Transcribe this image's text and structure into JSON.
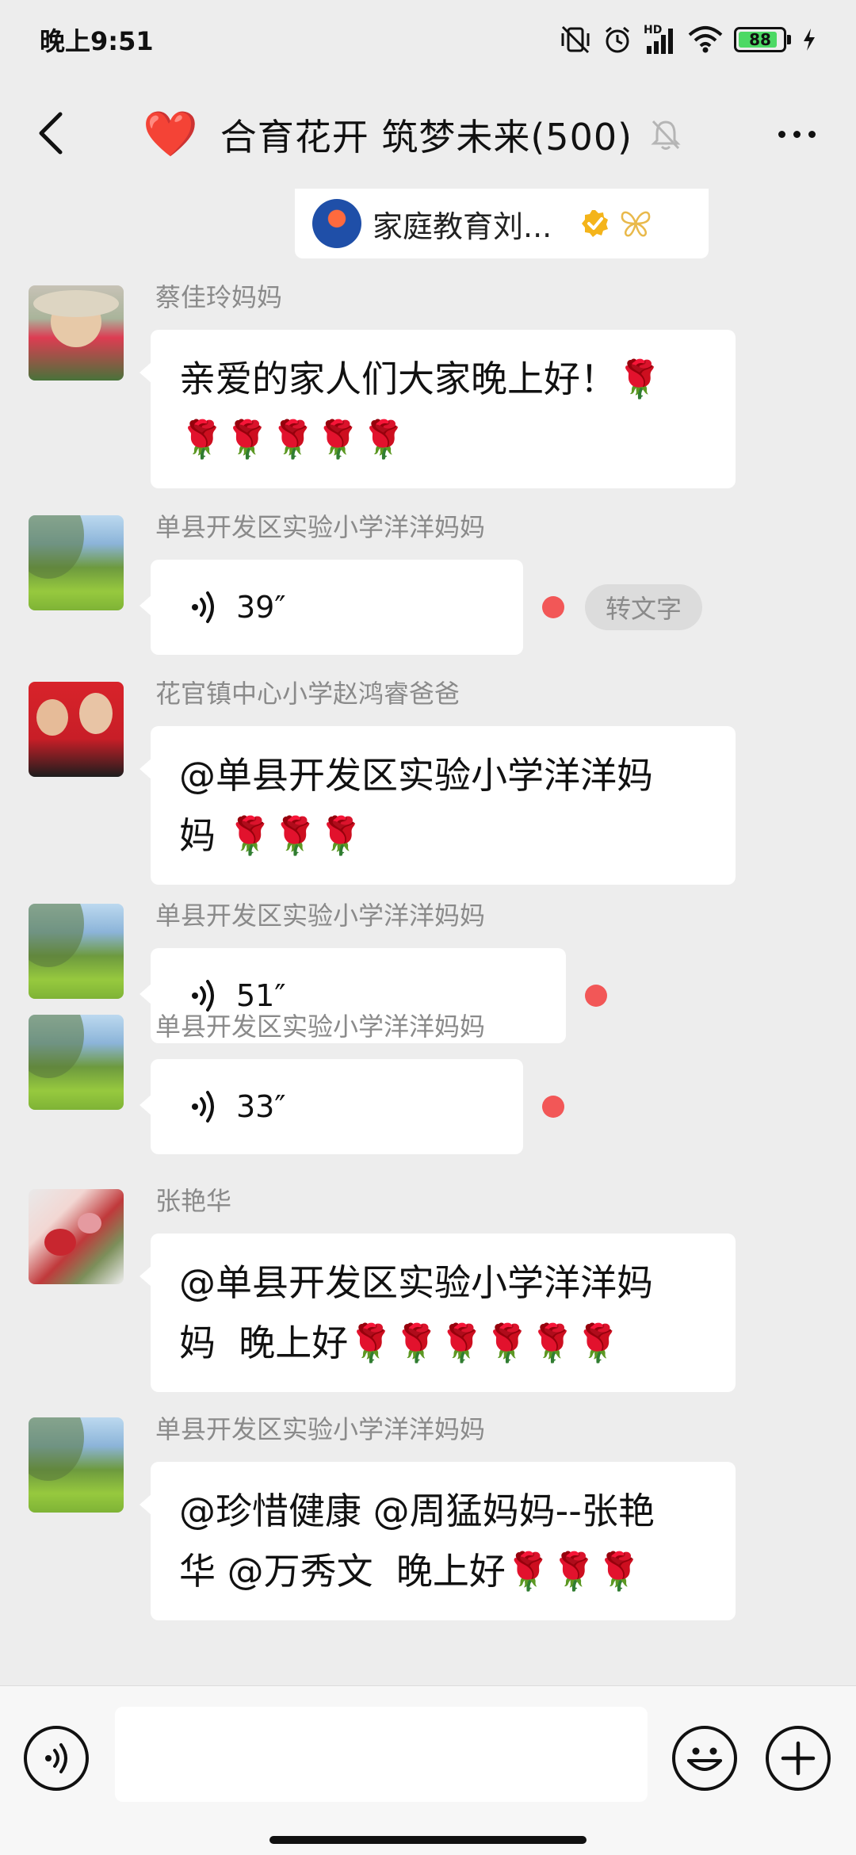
{
  "status_bar": {
    "time": "晚上9:51",
    "network": "HD",
    "battery_level": "88",
    "battery_fraction": 0.88
  },
  "header": {
    "title": "合育花开 筑梦未来(500)",
    "emoji": "❤️"
  },
  "pinned": {
    "name": "家庭教育刘..."
  },
  "messages": [
    {
      "type": "text",
      "sender": "蔡佳玲妈妈",
      "avatar": "girl",
      "text": "亲爱的家人们大家晚上好！🌹\n🌹🌹🌹🌹🌹"
    },
    {
      "type": "voice",
      "sender": "单县开发区实验小学洋洋妈妈",
      "avatar": "landscape",
      "duration": "39″",
      "unread": true,
      "transcribe_label": "转文字"
    },
    {
      "type": "text",
      "sender": "花官镇中心小学赵鸿睿爸爸",
      "avatar": "family",
      "text": "@单县开发区实验小学洋洋妈\n妈 🌹🌹🌹"
    },
    {
      "type": "voice",
      "sender": "单县开发区实验小学洋洋妈妈",
      "avatar": "landscape",
      "duration": "51″",
      "unread": true
    },
    {
      "type": "voice",
      "sender": "单县开发区实验小学洋洋妈妈",
      "avatar": "landscape",
      "duration": "33″",
      "unread": true
    },
    {
      "type": "text",
      "sender": "张艳华",
      "avatar": "flowers",
      "text": "@单县开发区实验小学洋洋妈\n妈  晚上好🌹🌹🌹🌹🌹🌹"
    },
    {
      "type": "text",
      "sender": "单县开发区实验小学洋洋妈妈",
      "avatar": "landscape",
      "text": "@珍惜健康 @周猛妈妈--张艳\n华 @万秀文  晚上好🌹🌹🌹"
    }
  ],
  "input_bar": {
    "placeholder": ""
  },
  "colors": {
    "background": "#ededed",
    "bubble": "#ffffff",
    "unread_dot": "#f25757",
    "battery": "#4cd964"
  }
}
